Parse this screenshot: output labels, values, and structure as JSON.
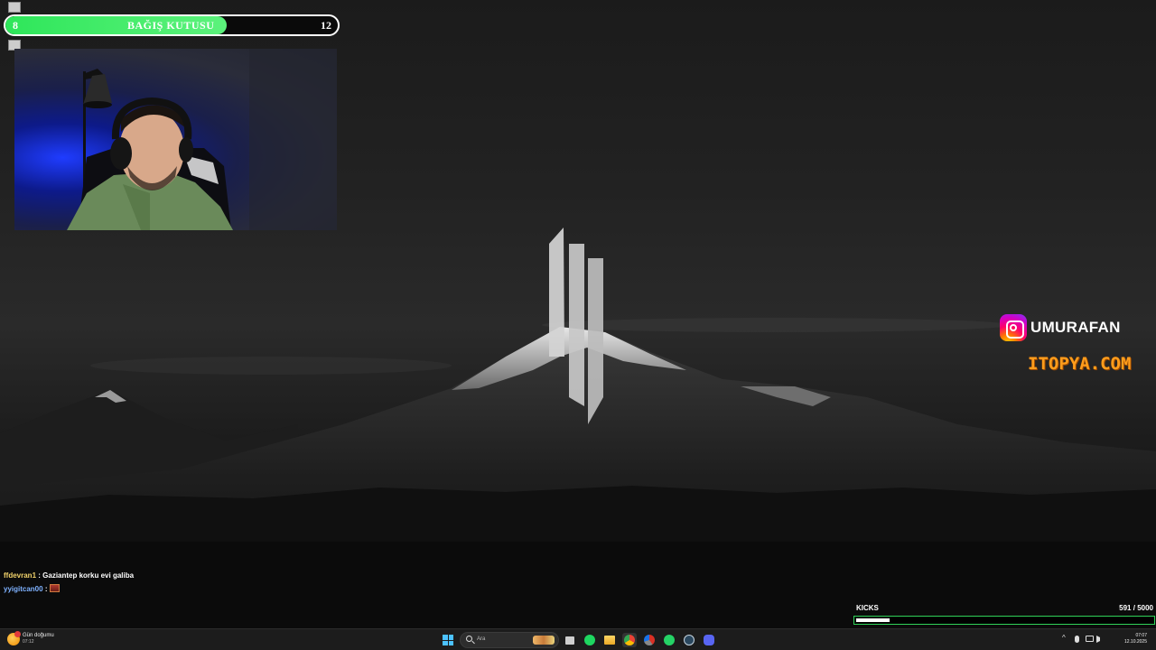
{
  "donation": {
    "title": "BAĞIŞ KUTUSU",
    "current": "8",
    "goal": "12",
    "progress": 0.667
  },
  "socials": {
    "instagram_handle": "UMURAFAN",
    "website": "ITOPYA.COM",
    "instagram_icon": "instagram-icon"
  },
  "chat": [
    {
      "user": "ffdevran1",
      "message": "Gaziantep korku evi galiba"
    },
    {
      "user": "yyigitcan00",
      "message": ""
    }
  ],
  "kicks": {
    "label": "KICKS",
    "current": "591",
    "goal": "/ 5000",
    "progress": 0.118
  },
  "taskbar": {
    "weather_title": "Gün doğumu",
    "weather_time": "07:12",
    "search_placeholder": "Ara",
    "clock_time": "07:07",
    "clock_date": "12.10.2025",
    "apps": [
      "windows-start-icon",
      "search-icon",
      "task-view-icon",
      "spotify-icon",
      "file-explorer-icon",
      "chrome-icon",
      "browser-icon",
      "whatsapp-icon",
      "steam-icon",
      "discord-icon"
    ]
  },
  "colors": {
    "donation_fill": "#2ee65a",
    "kicks_border": "#30d158",
    "instagram_gradient": "#ff0069",
    "website_orange": "#ff9d1c",
    "taskbar_bg": "#1c1c1c"
  }
}
